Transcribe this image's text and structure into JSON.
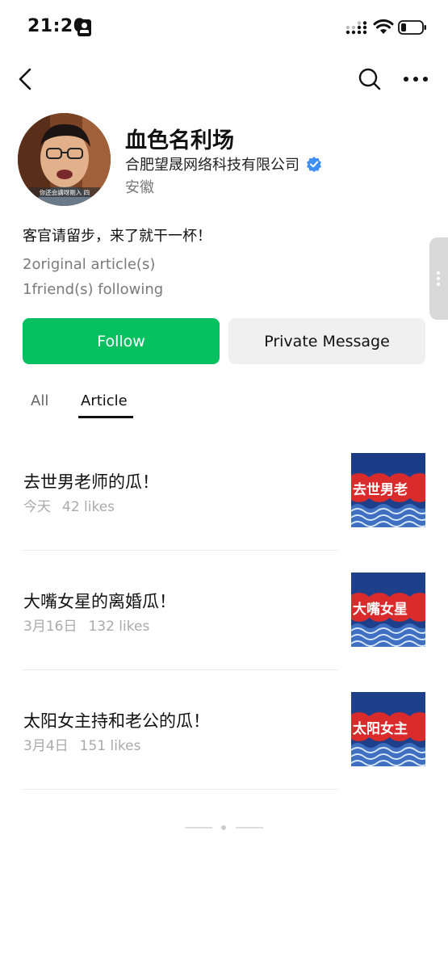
{
  "status_bar": {
    "time": "21:20"
  },
  "nav": {
    "back_icon": "chevron-left-icon",
    "search_icon": "search-icon",
    "more_icon": "more-horizontal-icon"
  },
  "profile": {
    "name": "血色名利场",
    "company": "合肥望晟网络科技有限公司",
    "verified_color": "#3d8ef7",
    "location": "安徽",
    "bio": "客官请留步，来了就干一杯！",
    "original_articles": "2original article(s)",
    "friends_following": "1friend(s) following",
    "avatar_caption": "你还会講呀剛入 四"
  },
  "actions": {
    "follow_label": "Follow",
    "private_message_label": "Private Message",
    "follow_color": "#07c160"
  },
  "tabs": [
    {
      "label": "All",
      "active": false
    },
    {
      "label": "Article",
      "active": true
    }
  ],
  "articles": [
    {
      "title": "去世男老师的瓜！",
      "date": "今天",
      "likes": "42 likes",
      "thumb_text": "去世男老"
    },
    {
      "title": "大嘴女星的离婚瓜！",
      "date": "3月16日",
      "likes": "132 likes",
      "thumb_text": "大嘴女星"
    },
    {
      "title": "太阳女主持和老公的瓜！",
      "date": "3月4日",
      "likes": "151 likes",
      "thumb_text": "太阳女主"
    }
  ]
}
